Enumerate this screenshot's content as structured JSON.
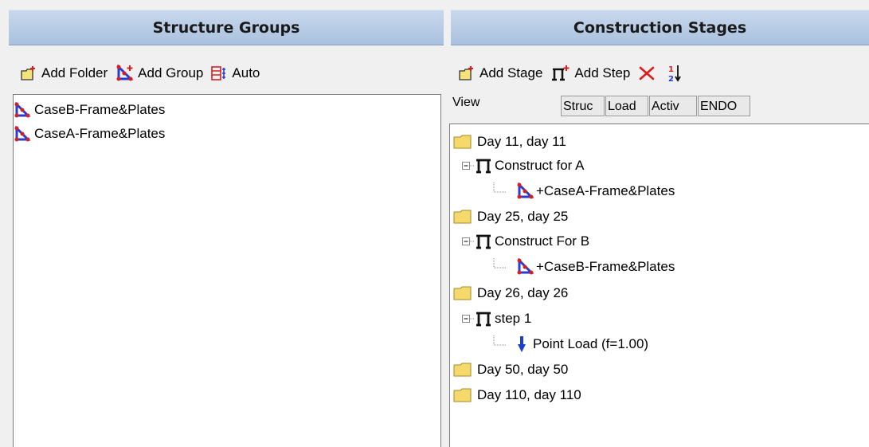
{
  "left_panel": {
    "header": "Structure Groups",
    "toolbar": {
      "add_folder": "Add Folder",
      "add_group": "Add Group",
      "auto": "Auto"
    },
    "items": [
      {
        "label": "CaseB-Frame&Plates",
        "icon": "frame-plates-group-icon"
      },
      {
        "label": "CaseA-Frame&Plates",
        "icon": "frame-plates-group-icon"
      }
    ]
  },
  "right_panel": {
    "header": "Construction Stages",
    "toolbar": {
      "add_stage": "Add Stage",
      "add_step": "Add Step",
      "delete_icon": "delete-x-icon",
      "sort_icon": "sort-1-2-icon"
    },
    "view_label": "View",
    "view_tabs": [
      "Struc",
      "Load",
      "Activ",
      "ENDO"
    ],
    "tree": [
      {
        "label": "Day 11, day 11",
        "icon": "folder-icon",
        "level": 0
      },
      {
        "label": "Construct for A",
        "icon": "step-icon",
        "level": 1
      },
      {
        "label": "+CaseA-Frame&Plates",
        "icon": "frame-plates-group-icon",
        "level": 2
      },
      {
        "label": "Day 25, day 25",
        "icon": "folder-icon",
        "level": 0
      },
      {
        "label": "Construct For B",
        "icon": "step-icon",
        "level": 1
      },
      {
        "label": "+CaseB-Frame&Plates",
        "icon": "frame-plates-group-icon",
        "level": 2
      },
      {
        "label": "Day 26, day 26",
        "icon": "folder-icon",
        "level": 0
      },
      {
        "label": "step 1",
        "icon": "step-icon",
        "level": 1
      },
      {
        "label": "Point Load (f=1.00)",
        "icon": "point-load-arrow-icon",
        "level": 2
      },
      {
        "label": "Day 50, day 50",
        "icon": "folder-icon",
        "level": 0
      },
      {
        "label": "Day 110, day 110",
        "icon": "folder-icon",
        "level": 0
      }
    ]
  },
  "colors": {
    "header_bg": "#a9c1de",
    "group_icon": "#d42020",
    "group_icon_frame": "#2a3bd0",
    "folder": "#f5d96b",
    "load_arrow": "#1d3fcc"
  }
}
